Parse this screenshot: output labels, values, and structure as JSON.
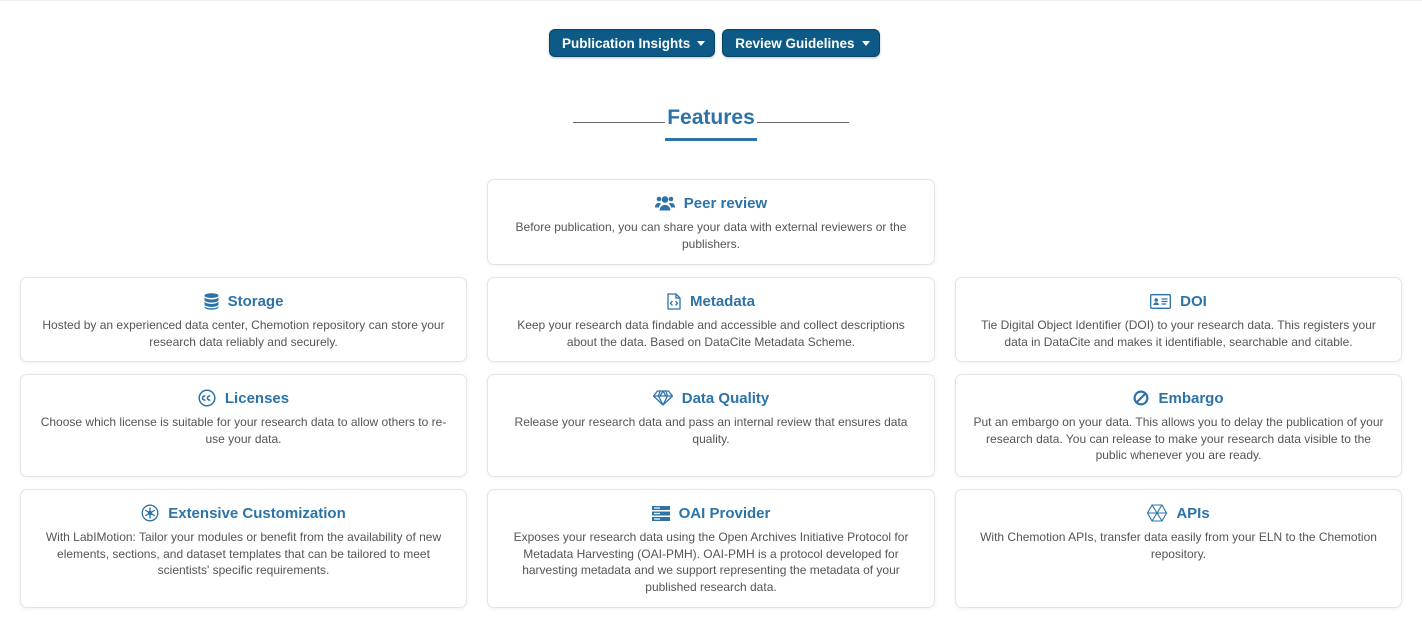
{
  "nav": {
    "publication_insights": "Publication Insights",
    "review_guidelines": "Review Guidelines"
  },
  "section": {
    "title": "Features"
  },
  "features": {
    "peer_review": {
      "title": "Peer review",
      "icon": "users-icon",
      "text": "Before publication, you can share your data with external reviewers or the publishers."
    },
    "storage": {
      "title": "Storage",
      "icon": "database-icon",
      "text": "Hosted by an experienced data center, Chemotion repository can store your research data reliably and securely."
    },
    "metadata": {
      "title": "Metadata",
      "icon": "file-code-icon",
      "text": "Keep your research data findable and accessible and collect descriptions about the data. Based on DataCite Metadata Scheme."
    },
    "doi": {
      "title": "DOI",
      "icon": "id-card-icon",
      "text": "Tie Digital Object Identifier (DOI) to your research data. This registers your data in DataCite and makes it identifiable, searchable and citable."
    },
    "licenses": {
      "title": "Licenses",
      "icon": "creative-commons-icon",
      "text": "Choose which license is suitable for your research data to allow others to re-use your data."
    },
    "data_quality": {
      "title": "Data Quality",
      "icon": "gem-icon",
      "text": "Release your research data and pass an internal review that ensures data quality."
    },
    "embargo": {
      "title": "Embargo",
      "icon": "ban-icon",
      "text": "Put an embargo on your data. This allows you to delay the publication of your research data. You can release to make your research data visible to the public whenever you are ready."
    },
    "customization": {
      "title": "Extensive Customization",
      "icon": "atom-gear-icon",
      "text": "With LabIMotion: Tailor your modules or benefit from the availability of new elements, sections, and dataset templates that can be tailored to meet scientists' specific requirements."
    },
    "oai_provider": {
      "title": "OAI Provider",
      "icon": "server-icon",
      "text": "Exposes your research data using the Open Archives Initiative Protocol for Metadata Harvesting (OAI-PMH). OAI-PMH is a protocol developed for harvesting metadata and we support representing the metadata of your published research data."
    },
    "apis": {
      "title": "APIs",
      "icon": "hexagon-network-icon",
      "text": "With Chemotion APIs, transfer data easily from your ELN to the Chemotion repository."
    }
  },
  "colors": {
    "nav_button": "#0d5a86",
    "accent": "#2c73a8"
  }
}
